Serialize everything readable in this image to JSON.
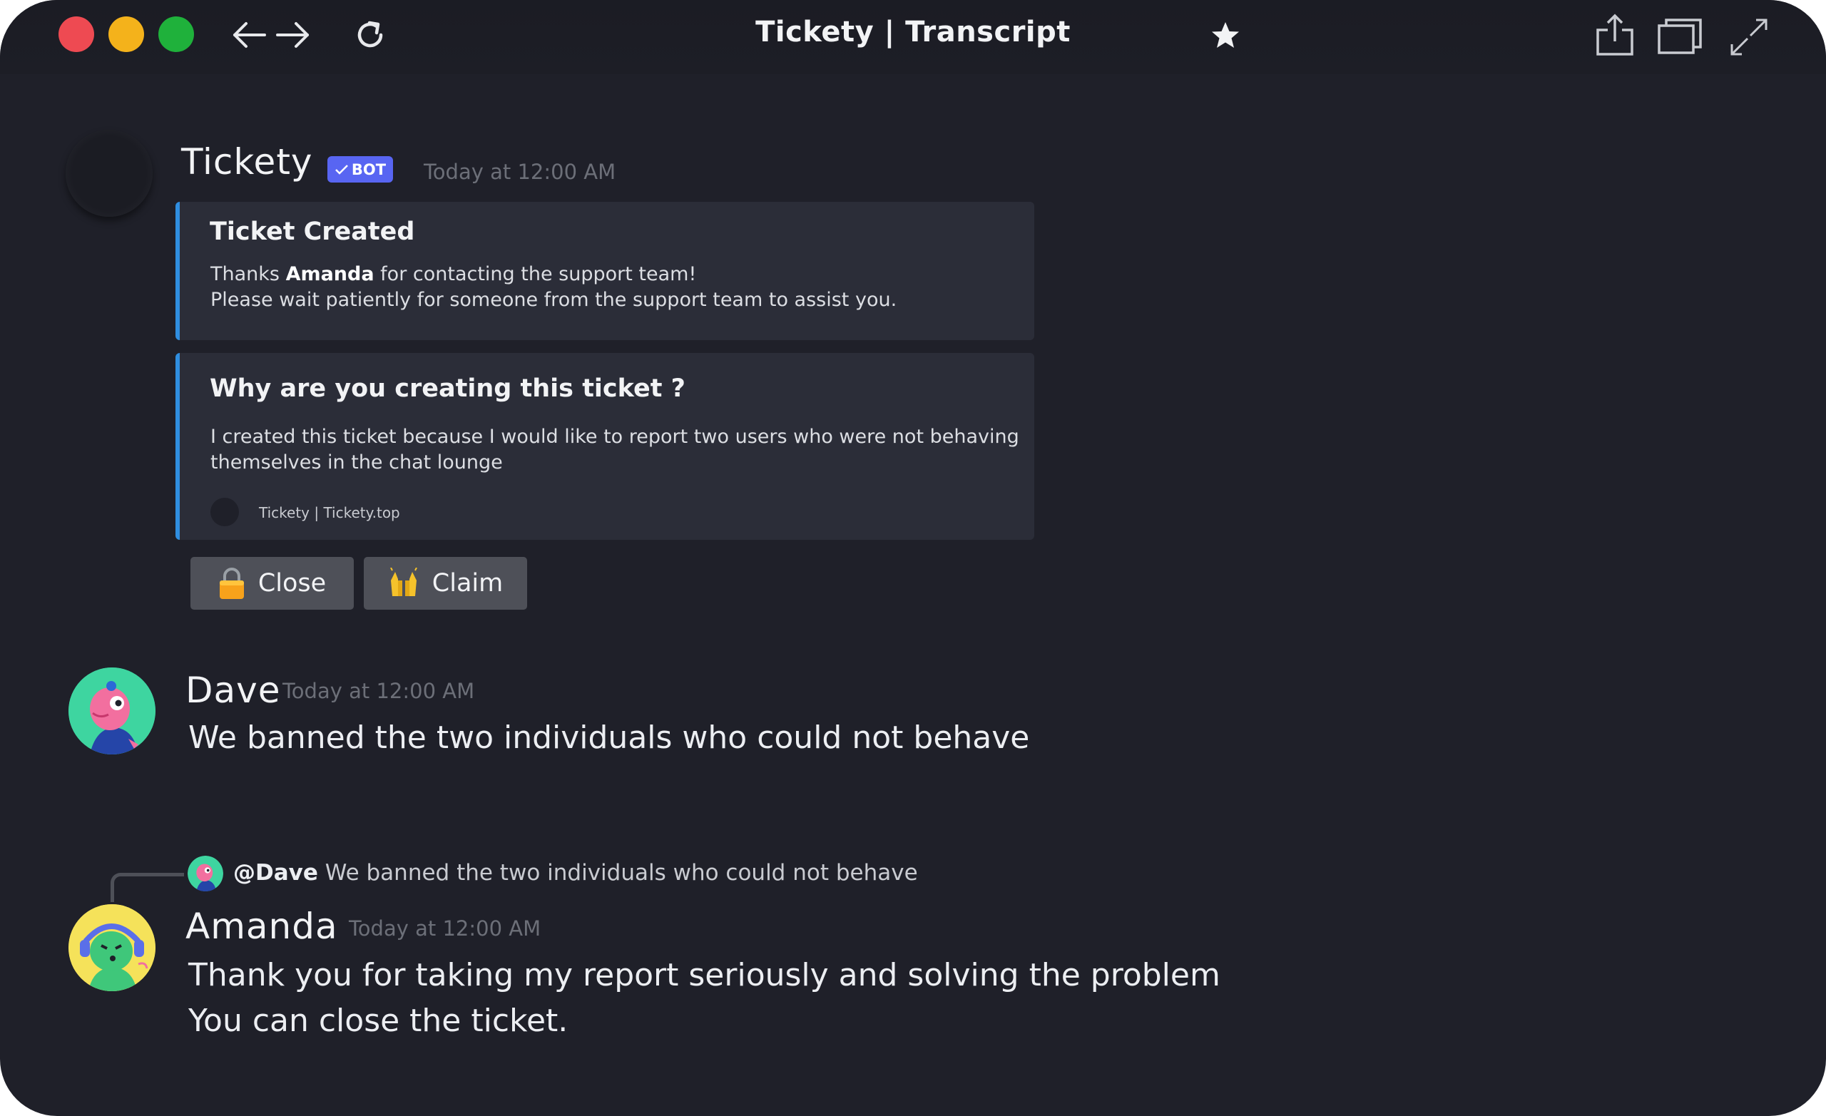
{
  "window": {
    "title": "Tickety | Transcript"
  },
  "toolbar": {
    "icons": [
      "back-arrow-icon",
      "forward-arrow-icon",
      "reload-icon",
      "star-icon",
      "share-icon",
      "tabs-icon",
      "fullscreen-icon"
    ]
  },
  "bot_message": {
    "author": "Tickety",
    "badge": "BOT",
    "timestamp": "Today at 12:00 AM",
    "embed1": {
      "title": "Ticket Created",
      "line1_pre": "Thanks ",
      "line1_bold": "Amanda",
      "line1_post": " for contacting the support team!",
      "line2": "Please wait patiently for someone from the support team to assist you."
    },
    "embed2": {
      "title": "Why are you creating this ticket ?",
      "line1": "I created this ticket because I would like to report two users who were not behaving",
      "line2": "themselves in the chat lounge",
      "footer": "Tickety | Tickety.top"
    },
    "buttons": [
      {
        "label": "Close",
        "icon": "lock-icon"
      },
      {
        "label": "Claim",
        "icon": "raised-hands-icon"
      }
    ]
  },
  "dave_message": {
    "author": "Dave",
    "timestamp": "Today at 12:00 AM",
    "text": "We banned the two individuals who could not behave"
  },
  "amanda_message": {
    "reply": {
      "mention": "@Dave",
      "text": " We banned the two individuals who could not behave"
    },
    "author": "Amanda",
    "timestamp": "Today at 12:00 AM",
    "line1": "Thank you for taking my report seriously and solving the problem",
    "line2": "You can close the ticket."
  },
  "colors": {
    "background": "#1f2029",
    "embed_bg": "#2b2d38",
    "embed_accent": "#2f8ee0",
    "bot_badge": "#5865f2",
    "button": "#4e5058"
  }
}
